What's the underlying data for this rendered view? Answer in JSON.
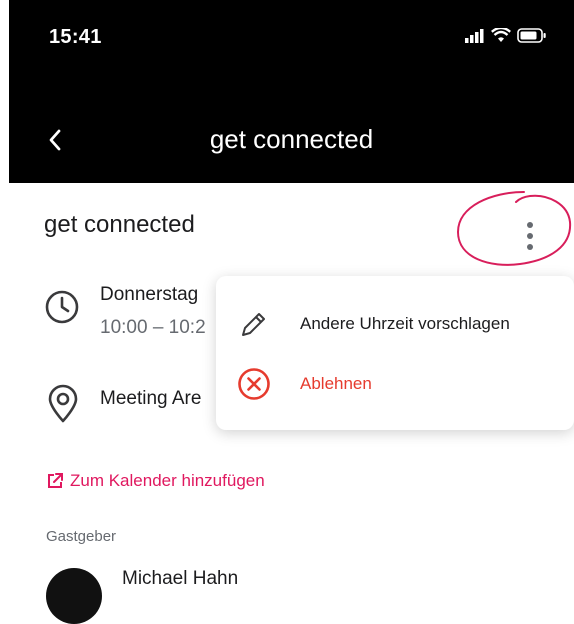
{
  "status_bar": {
    "time": "15:41"
  },
  "nav": {
    "title": "get connected"
  },
  "event": {
    "title": "get connected",
    "date_line": "Donnerstag",
    "time_line": "10:00 – 10:2",
    "location": "Meeting Are",
    "add_to_calendar": "Zum Kalender hinzufügen",
    "host_label": "Gastgeber",
    "host_name": "Michael Hahn"
  },
  "menu": {
    "items": [
      {
        "label": "Andere Uhrzeit vorschlagen",
        "icon": "pencil-icon"
      },
      {
        "label": "Ablehnen",
        "icon": "close-circle-icon",
        "color": "#e63b2e"
      }
    ]
  },
  "colors": {
    "accent": "#e0185f",
    "danger": "#e63b2e"
  }
}
